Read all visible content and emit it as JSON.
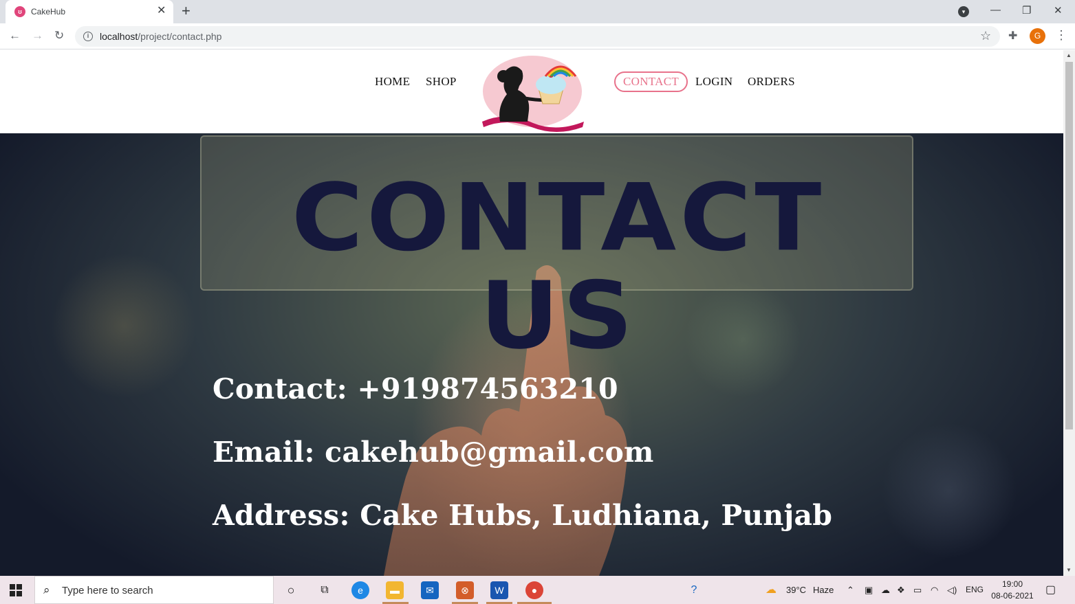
{
  "browser": {
    "tab_title": "CakeHub",
    "tab_favicon": "cakehub-favicon",
    "url_host": "localhost",
    "url_path": "/project/contact.php"
  },
  "site": {
    "nav_left": [
      "HOME",
      "SHOP"
    ],
    "nav_right": [
      "CONTACT",
      "LOGIN",
      "ORDERS"
    ],
    "active_nav": "CONTACT",
    "accent_color": "#e8728b"
  },
  "hero": {
    "title": "CONTACT US",
    "contact_line": "Contact: +919874563210",
    "email_line": "Email: cakehub@gmail.com",
    "address_line": "Address: Cake Hubs, Ludhiana, Punjab"
  },
  "taskbar": {
    "search_placeholder": "Type here to search",
    "weather": "39°C",
    "weather_desc": "Haze",
    "lang": "ENG",
    "time": "19:00",
    "date": "08-06-2021",
    "avatar_letter": "G"
  }
}
